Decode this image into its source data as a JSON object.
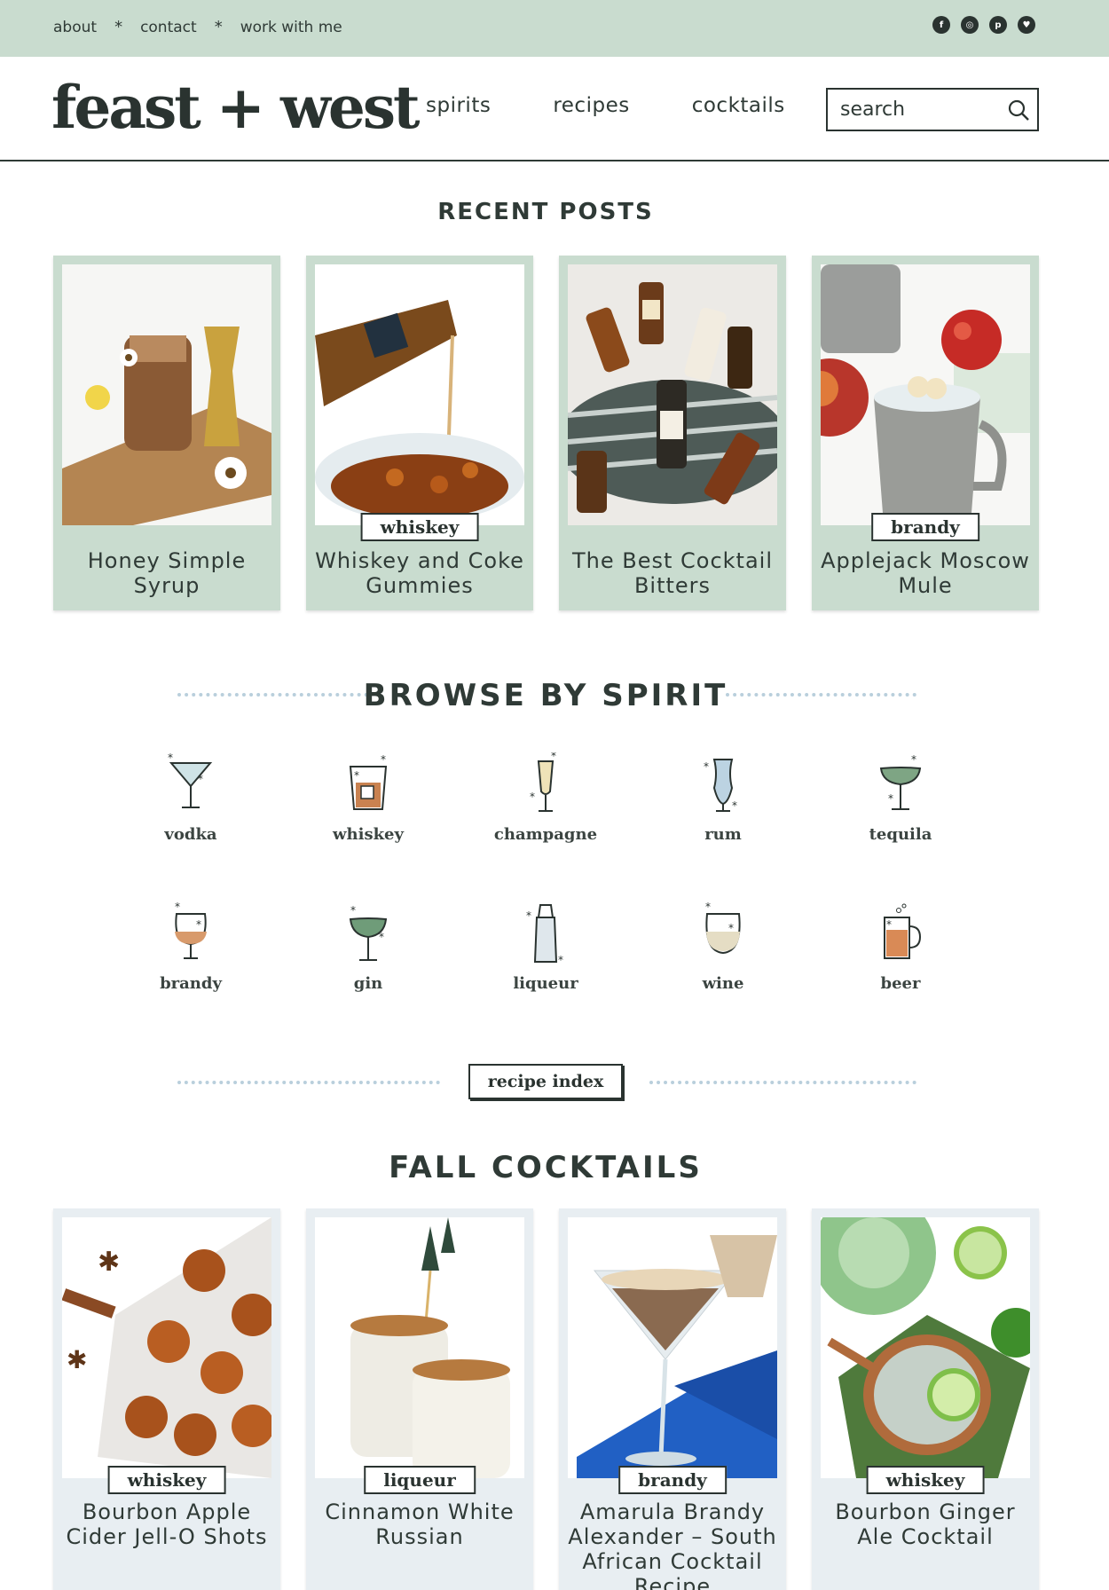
{
  "topnav": {
    "items": [
      "about",
      "contact",
      "work with me"
    ],
    "separator": "*"
  },
  "social": [
    "facebook-icon",
    "instagram-icon",
    "pinterest-icon",
    "twitter-icon"
  ],
  "logo": "feast + west",
  "mainnav": [
    "spirits",
    "recipes",
    "cocktails"
  ],
  "search": {
    "placeholder": "search"
  },
  "recent": {
    "title": "RECENT POSTS",
    "posts": [
      {
        "title": "Honey Simple Syrup",
        "category": ""
      },
      {
        "title": "Whiskey and Coke Gummies",
        "category": "whiskey"
      },
      {
        "title": "The Best Cocktail Bitters",
        "category": ""
      },
      {
        "title": "Applejack Moscow Mule",
        "category": "brandy"
      }
    ]
  },
  "browse": {
    "title": "BROWSE BY SPIRIT",
    "spirits": [
      "vodka",
      "whiskey",
      "champagne",
      "rum",
      "tequila",
      "brandy",
      "gin",
      "liqueur",
      "wine",
      "beer"
    ]
  },
  "recipe_index": "recipe index",
  "fall": {
    "title": "FALL COCKTAILS",
    "posts": [
      {
        "title": "Bourbon Apple Cider Jell-O Shots",
        "category": "whiskey"
      },
      {
        "title": "Cinnamon White Russian",
        "category": "liqueur"
      },
      {
        "title": "Amarula Brandy Alexander – South African Cocktail Recipe",
        "category": "brandy"
      },
      {
        "title": "Bourbon Ginger Ale Cocktail",
        "category": "whiskey"
      }
    ]
  },
  "colors": {
    "accent": "#c9dccf",
    "text": "#2f3a36",
    "dots": "#b9cfdc",
    "fall_card": "#e8eef2"
  }
}
